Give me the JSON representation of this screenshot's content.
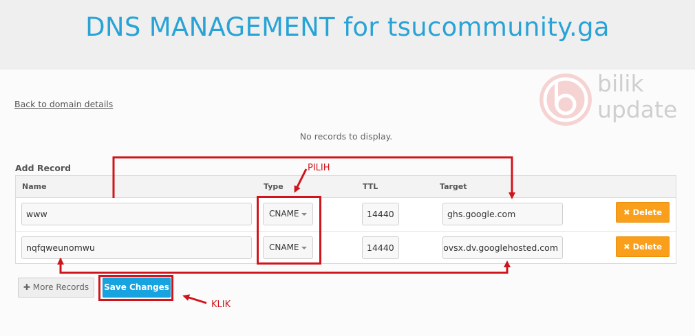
{
  "header": {
    "title": "DNS MANAGEMENT for tsucommunity.ga"
  },
  "nav": {
    "back_link": "Back to domain details"
  },
  "records": {
    "empty_message": "No records to display."
  },
  "add_record": {
    "title": "Add Record",
    "columns": {
      "name": "Name",
      "type": "Type",
      "ttl": "TTL",
      "target": "Target"
    },
    "rows": [
      {
        "name": "www",
        "type": "CNAME",
        "ttl": "14440",
        "target": "ghs.google.com",
        "delete_label": "Delete"
      },
      {
        "name": "nqfqweunomwu",
        "type": "CNAME",
        "ttl": "14440",
        "target": "povsx.dv.googlehosted.com",
        "delete_label": "Delete"
      }
    ]
  },
  "actions": {
    "more_records_label": "More Records",
    "save_label": "Save Changes"
  },
  "annotations": {
    "pilih": "PILIH",
    "klik": "KLIK"
  },
  "watermark": {
    "line1": "bilik",
    "line2": "update"
  },
  "colors": {
    "accent": "#29a3d6",
    "delete": "#f99f1c",
    "save": "#17a3e0",
    "annotation": "#d0141b",
    "watermark": "#f0b4b4"
  },
  "icons": {
    "delete": "times-icon",
    "more": "plus-icon",
    "select": "caret-down-icon"
  }
}
